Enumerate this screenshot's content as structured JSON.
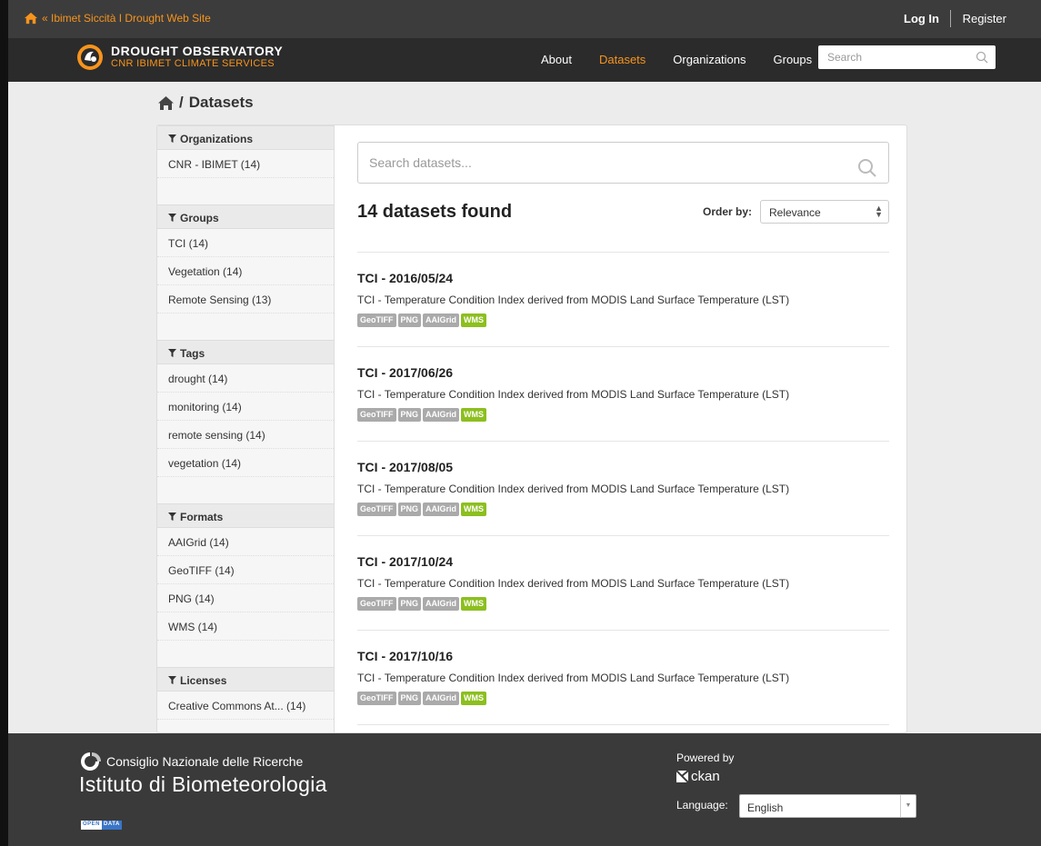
{
  "account": {
    "site_link": "« Ibimet Siccità I Drought Web Site",
    "login": "Log In",
    "register": "Register"
  },
  "brand": {
    "title": "DROUGHT OBSERVATORY",
    "subtitle": "CNR IBIMET CLIMATE SERVICES"
  },
  "nav": {
    "items": [
      {
        "label": "About",
        "active": false
      },
      {
        "label": "Datasets",
        "active": true
      },
      {
        "label": "Organizations",
        "active": false
      },
      {
        "label": "Groups",
        "active": false
      }
    ],
    "search_placeholder": "Search"
  },
  "breadcrumb": {
    "current": "Datasets"
  },
  "facets": {
    "organizations": {
      "title": "Organizations",
      "items": [
        "CNR - IBIMET (14)"
      ]
    },
    "groups": {
      "title": "Groups",
      "items": [
        "TCI (14)",
        "Vegetation (14)",
        "Remote Sensing (13)"
      ]
    },
    "tags": {
      "title": "Tags",
      "items": [
        "drought (14)",
        "monitoring (14)",
        "remote sensing (14)",
        "vegetation (14)"
      ]
    },
    "formats": {
      "title": "Formats",
      "items": [
        "AAIGrid (14)",
        "GeoTIFF (14)",
        "PNG (14)",
        "WMS (14)"
      ]
    },
    "licenses": {
      "title": "Licenses",
      "items": [
        "Creative Commons At... (14)"
      ]
    }
  },
  "search": {
    "placeholder": "Search datasets...",
    "results_label": "14 datasets found",
    "order_label": "Order by:",
    "order_value": "Relevance"
  },
  "datasets": [
    {
      "title": "TCI - 2016/05/24",
      "notes": "TCI - Temperature Condition Index derived from MODIS Land Surface Temperature (LST)",
      "formats": [
        "GeoTIFF",
        "PNG",
        "AAIGrid",
        "WMS"
      ]
    },
    {
      "title": "TCI - 2017/06/26",
      "notes": "TCI - Temperature Condition Index derived from MODIS Land Surface Temperature (LST)",
      "formats": [
        "GeoTIFF",
        "PNG",
        "AAIGrid",
        "WMS"
      ]
    },
    {
      "title": "TCI - 2017/08/05",
      "notes": "TCI - Temperature Condition Index derived from MODIS Land Surface Temperature (LST)",
      "formats": [
        "GeoTIFF",
        "PNG",
        "AAIGrid",
        "WMS"
      ]
    },
    {
      "title": "TCI - 2017/10/24",
      "notes": "TCI - Temperature Condition Index derived from MODIS Land Surface Temperature (LST)",
      "formats": [
        "GeoTIFF",
        "PNG",
        "AAIGrid",
        "WMS"
      ]
    },
    {
      "title": "TCI - 2017/10/16",
      "notes": "TCI - Temperature Condition Index derived from MODIS Land Surface Temperature (LST)",
      "formats": [
        "GeoTIFF",
        "PNG",
        "AAIGrid",
        "WMS"
      ]
    }
  ],
  "footer": {
    "org_line1": "Consiglio Nazionale delle Ricerche",
    "org_line2": "Istituto di Biometeorologia",
    "badge_left": "OPEN",
    "badge_right": "DATA",
    "powered_by": "Powered by",
    "ckan": "ckan",
    "language_label": "Language:",
    "language_value": "English"
  },
  "colors": {
    "accent": "#f7941d",
    "wms": "#8cbf1f",
    "format_badge": "#aaaaaa"
  }
}
